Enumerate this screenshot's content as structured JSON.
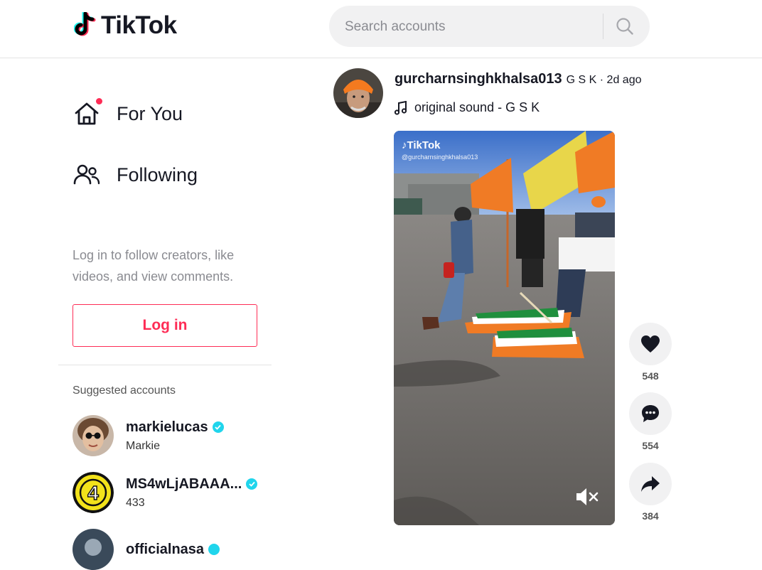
{
  "header": {
    "logo_text": "TikTok",
    "search_placeholder": "Search accounts"
  },
  "sidebar": {
    "nav": [
      {
        "label": "For You",
        "icon": "home-icon"
      },
      {
        "label": "Following",
        "icon": "users-icon"
      }
    ],
    "login_prompt": "Log in to follow creators, like videos, and view comments.",
    "login_button": "Log in",
    "suggested_title": "Suggested accounts",
    "accounts": [
      {
        "username": "markielucas",
        "nickname": "Markie",
        "verified": true
      },
      {
        "username": "MS4wLjABAAA...",
        "nickname": "433",
        "verified": true
      },
      {
        "username": "officialnasa",
        "nickname": "",
        "verified": true
      }
    ]
  },
  "post": {
    "username": "gurcharnsinghkhalsa013",
    "meta": "G S K · 2d ago",
    "sound": "original sound - G S K",
    "watermark_logo": "TikTok",
    "watermark_user": "@gurcharnsinghkhalsa013",
    "likes": "548",
    "comments": "554",
    "shares": "384"
  },
  "colors": {
    "brand_red": "#fe2c55",
    "brand_cyan": "#20d5ec",
    "text": "#161823"
  }
}
